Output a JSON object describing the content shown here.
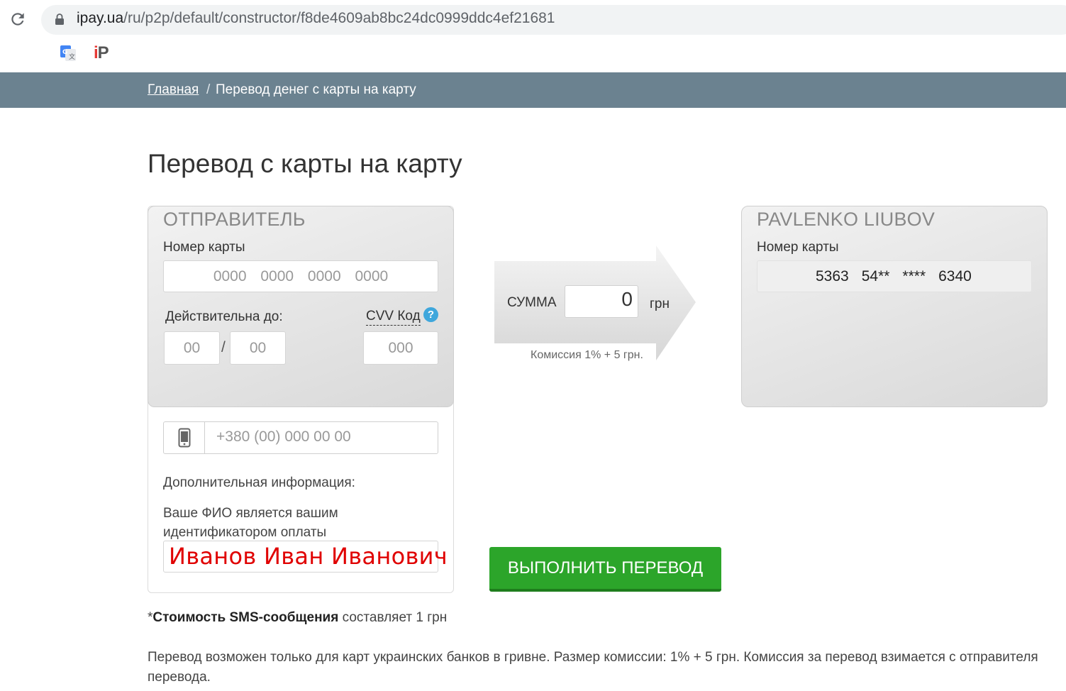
{
  "browser": {
    "url_host": "ipay.ua",
    "url_path": "/ru/p2p/default/constructor/f8de4609ab8bc24dc0999ddc4ef21681",
    "icons": [
      "reload-icon",
      "lock-icon",
      "translate-icon",
      "ipay-extension-icon"
    ],
    "extension_label_i": "i",
    "extension_label_p": "P"
  },
  "breadcrumb": {
    "home": "Главная",
    "separator": "/",
    "current": "Перевод денег с карты на карту"
  },
  "page_title": "Перевод с карты на карту",
  "sender": {
    "heading": "ОТПРАВИТЕЛЬ",
    "card_label": "Номер карты",
    "card_placeholder": "0000 0000 0000 0000",
    "expiry_label": "Действительна до:",
    "month_placeholder": "00",
    "year_placeholder": "00",
    "slash": "/",
    "cvv_label": "CVV Код",
    "cvv_help": "?",
    "cvv_placeholder": "000",
    "phone_placeholder": "+380 (00) 000 00 00",
    "extra_label": "Дополнительная информация:",
    "fio_note": "Ваше ФИО является вашим идентификатором оплаты",
    "fio_value": "Иванов Иван Иванович"
  },
  "amount": {
    "label": "СУММА",
    "value": "0",
    "currency": "грн",
    "commission": "Комиссия 1% + 5 грн."
  },
  "receiver": {
    "heading": "PAVLENKO LIUBOV",
    "card_label": "Номер карты",
    "card_parts": [
      "5363",
      "54**",
      "****",
      "6340"
    ]
  },
  "submit_label": "ВЫПОЛНИТЬ ПЕРЕВОД",
  "sms_note": {
    "prefix": "*",
    "bold": "Стоимость SMS-сообщения",
    "rest": " составляет 1 грн"
  },
  "bottom_note": "Перевод возможен только для карт украинских банков в гривне. Размер комиссии: 1% + 5 грн. Комиссия за перевод взимается с отправителя перевода.",
  "colors": {
    "breadcrumb_bg": "#6b8290",
    "submit_bg": "#2ca52a",
    "fio_text": "#e00000",
    "help_icon": "#3fa7dc"
  }
}
